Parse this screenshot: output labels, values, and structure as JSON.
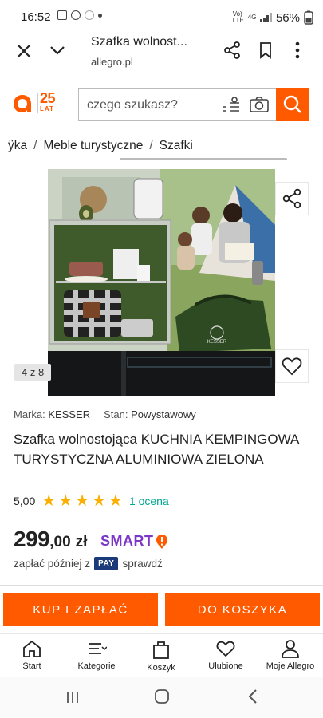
{
  "status_bar": {
    "time": "16:52",
    "battery": "56%",
    "network": "4G"
  },
  "browser": {
    "title": "Szafka wolnost...",
    "url": "allegro.pl"
  },
  "header": {
    "logo_number": "25",
    "logo_sub": "LAT",
    "search_placeholder": "czego szukasz?"
  },
  "breadcrumbs": [
    "ÿka",
    "Meble turystyczne",
    "Szafki"
  ],
  "gallery": {
    "counter": "4 z 8",
    "image_text": "KESSER"
  },
  "product": {
    "brand_label": "Marka:",
    "brand": "KESSER",
    "condition_label": "Stan:",
    "condition": "Powystawowy",
    "title": "Szafka wolnostojąca KUCHNIA KEMPINGOWA TURYSTYCZNA ALUMINIOWA ZIELONA",
    "rating_value": "5,00",
    "rating_count": "1 ocena",
    "stars": 5
  },
  "price": {
    "main": "299",
    "decimals": ",00",
    "currency": "zł",
    "smart_label": "SMART"
  },
  "pay_later": {
    "text_before": "zapłać później z",
    "badge": "PAY",
    "text_after": "sprawdź"
  },
  "actions": {
    "buy": "KUP I ZAPŁAĆ",
    "add_to_cart": "DO KOSZYKA"
  },
  "bottom_nav": [
    "Start",
    "Kategorie",
    "Koszyk",
    "Ulubione",
    "Moje Allegro"
  ],
  "colors": {
    "accent": "#ff5a00",
    "star": "#fbaf00",
    "link": "#00a790",
    "smart": "#7b38c8"
  }
}
